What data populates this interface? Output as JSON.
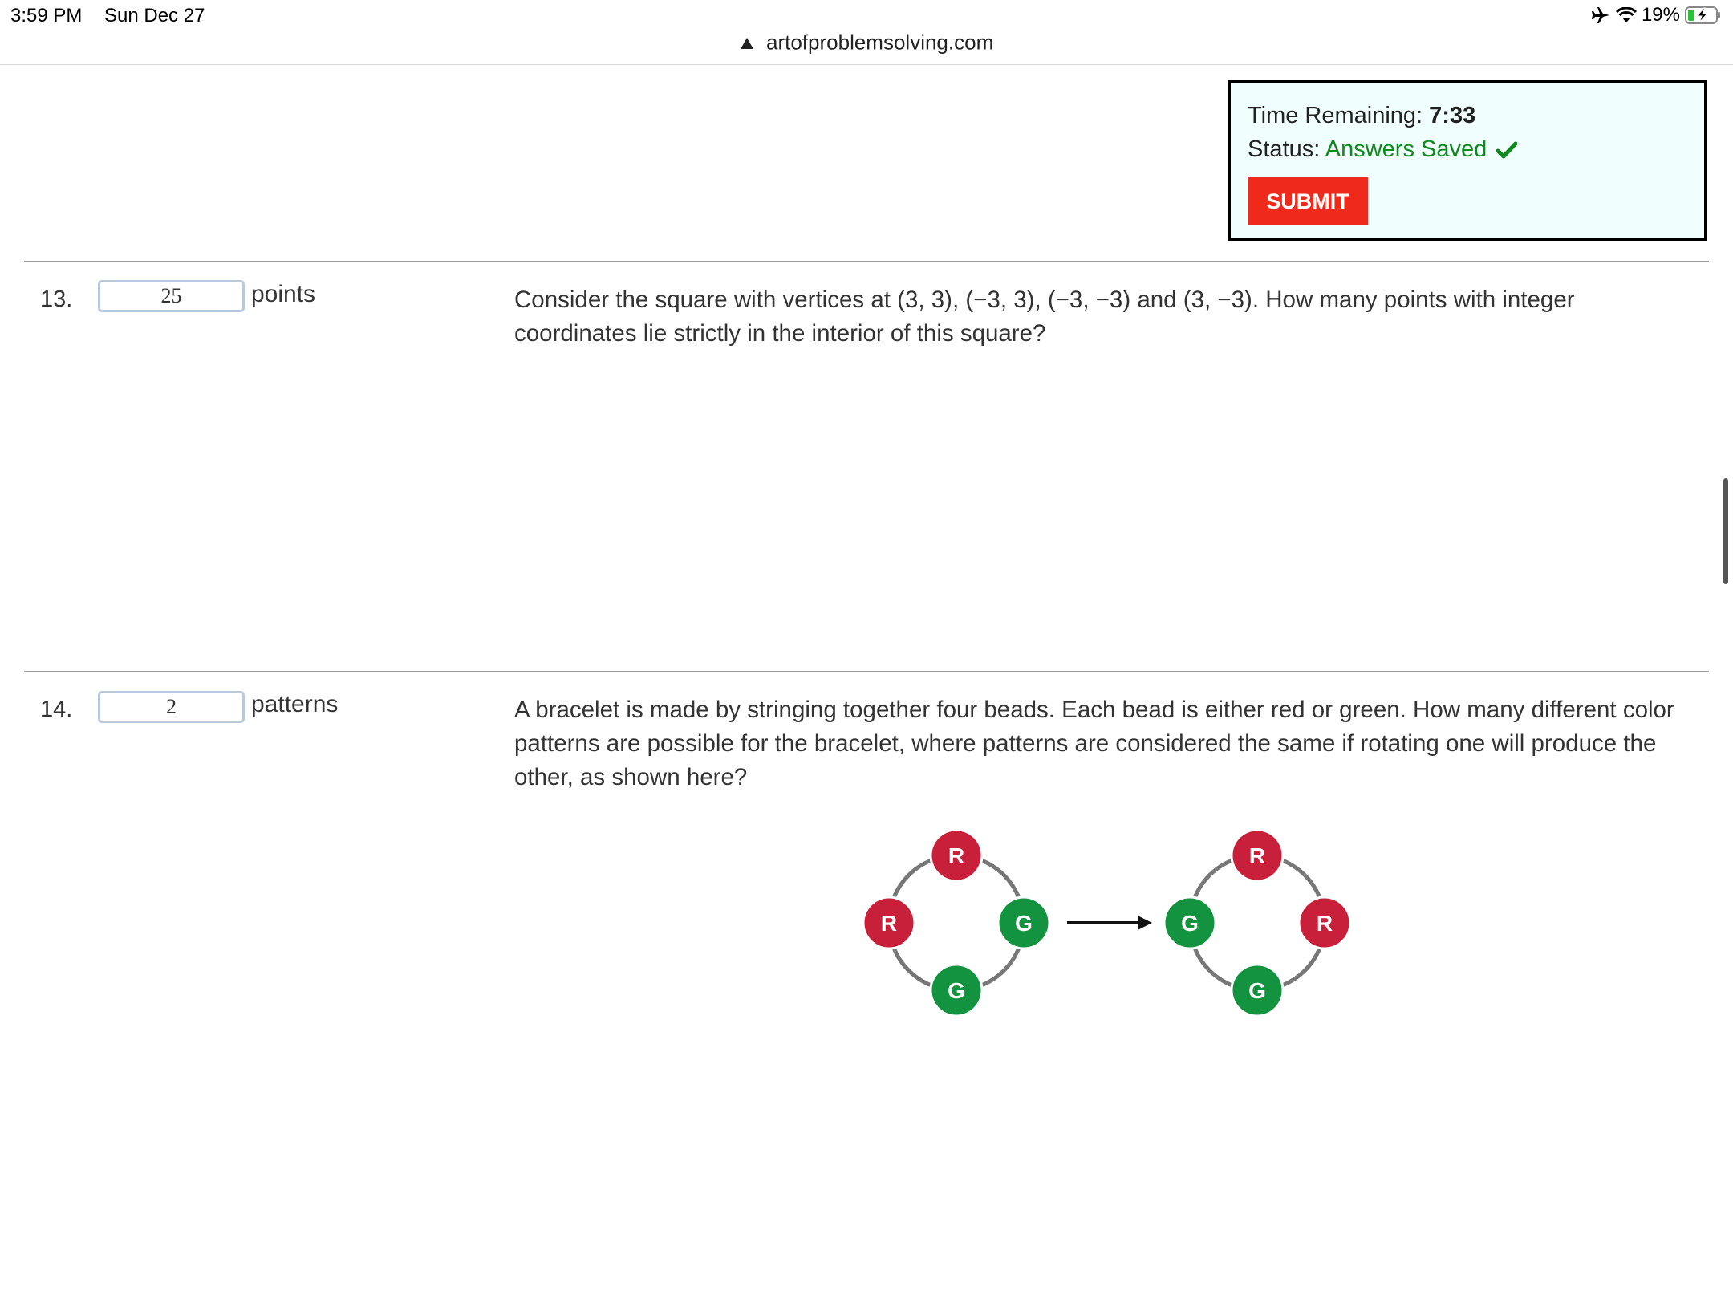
{
  "status_bar": {
    "time": "3:59 PM",
    "date": "Sun Dec 27",
    "battery": "19%"
  },
  "browser": {
    "domain": "artofproblemsolving.com"
  },
  "timer": {
    "label": "Time Remaining:",
    "value": "7:33",
    "status_label": "Status:",
    "status_value": "Answers Saved",
    "submit_label": "SUBMIT"
  },
  "questions": [
    {
      "number": "13.",
      "answer": "25",
      "unit": "points",
      "text": "Consider the square with vertices at (3, 3), (−3, 3), (−3, −3) and (3, −3). How many points with integer coordinates lie strictly in the interior of this square?"
    },
    {
      "number": "14.",
      "answer": "2",
      "unit": "patterns",
      "text": "A bracelet is made by stringing together four beads. Each bead is either red or green. How many different color patterns are possible for the bracelet, where patterns are considered the same if rotating one will produce the other, as shown here?"
    }
  ],
  "figure": {
    "left_bracelet": {
      "top": "R",
      "left": "R",
      "right": "G",
      "bottom": "G"
    },
    "right_bracelet": {
      "top": "R",
      "left": "G",
      "right": "R",
      "bottom": "G"
    },
    "colors": {
      "red": "#c8203a",
      "green": "#13933f",
      "ring": "#777777"
    }
  }
}
